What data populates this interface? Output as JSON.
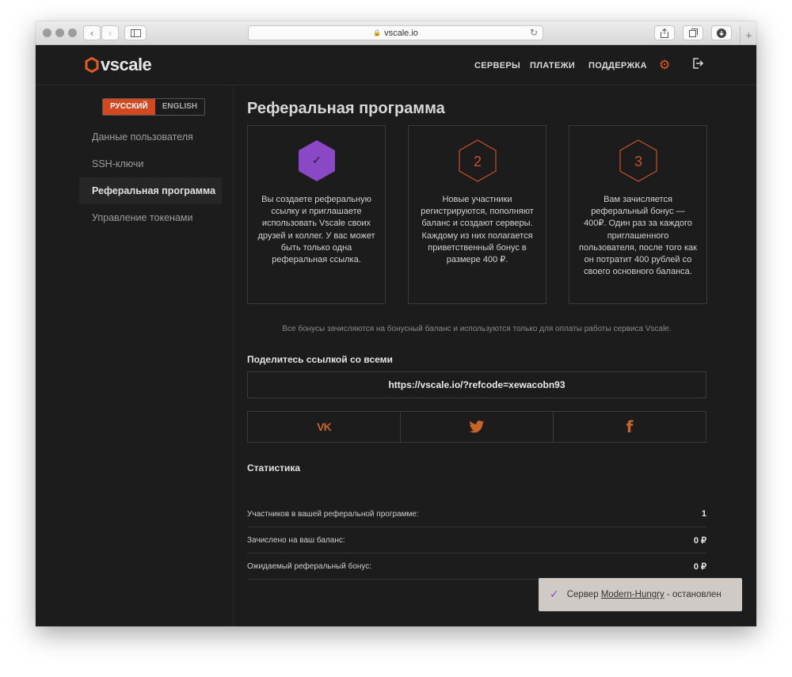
{
  "browser": {
    "url": "vscale.io"
  },
  "header": {
    "logo_text": "vscale",
    "nav": [
      "СЕРВЕРЫ",
      "ПЛАТЕЖИ",
      "ПОДДЕРЖКА"
    ]
  },
  "sidebar": {
    "lang_ru": "РУССКИЙ",
    "lang_en": "ENGLISH",
    "items": [
      {
        "label": "Данные пользователя"
      },
      {
        "label": "SSH-ключи"
      },
      {
        "label": "Реферальная программа"
      },
      {
        "label": "Управление токенами"
      }
    ]
  },
  "main": {
    "title": "Реферальная программа",
    "steps": [
      {
        "badge": "✓",
        "text": "Вы создаете реферальную ссылку и приглашаете использовать Vscale своих друзей и коллег. У вас может быть только одна реферальная ссылка."
      },
      {
        "badge": "2",
        "text": "Новые участники регистрируются, пополняют баланс и создают серверы. Каждому из них полагается приветственный бонус в размере 400 ₽."
      },
      {
        "badge": "3",
        "text": "Вам зачисляется реферальный бонус — 400₽. Один раз за каждого приглашенного пользователя, после того как он потратит 400 рублей со своего основного баланса."
      }
    ],
    "note": "Все бонусы зачисляются на бонусный баланс и используются только для оплаты работы сервиса Vscale.",
    "share_title": "Поделитесь ссылкой со всеми",
    "ref_link": "https://vscale.io/?refcode=xewacobn93",
    "social": {
      "vk": "VK",
      "fb": "f"
    },
    "stats_title": "Статистика",
    "stats": [
      {
        "label": "Участников в вашей реферальной программе:",
        "value": "1"
      },
      {
        "label": "Зачислено на ваш баланс:",
        "value": "0 ₽"
      },
      {
        "label": "Ожидаемый реферальный бонус:",
        "value": "0 ₽"
      }
    ]
  },
  "toast": {
    "prefix": "Сервер",
    "server": "Modern-Hungry",
    "suffix": "- остановлен"
  },
  "colors": {
    "accent": "#e05a23",
    "purple": "#8a48c7",
    "background": "#1c1c1c"
  }
}
